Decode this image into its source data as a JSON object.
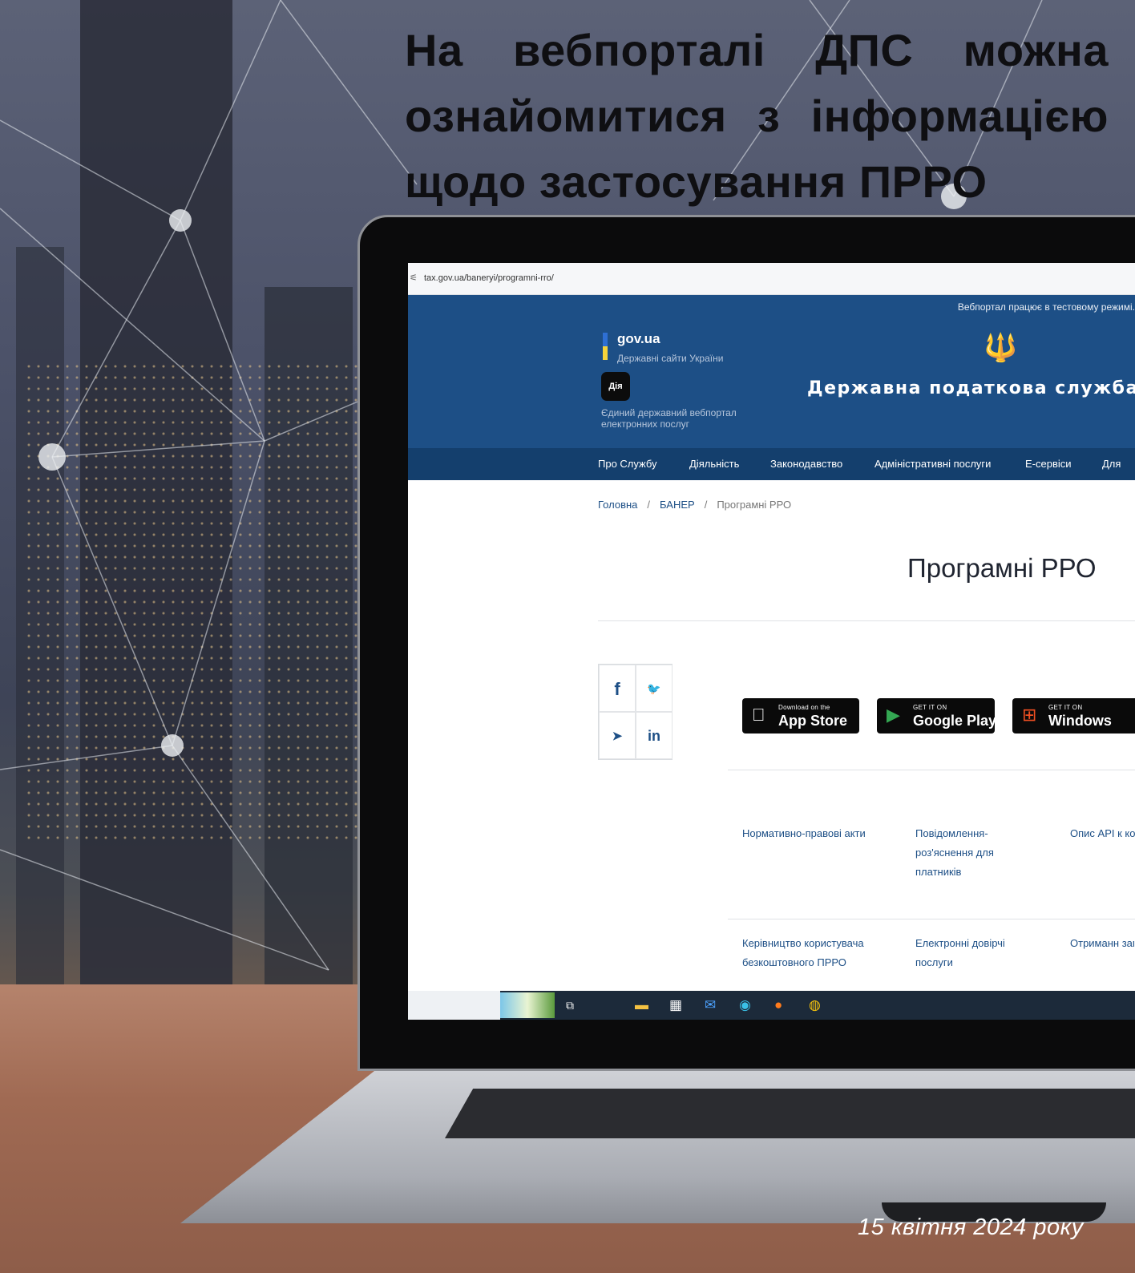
{
  "headline": "На вебпорталі ДПС можна ознайомитися з інформацією щодо застосування ПРРО",
  "date": "15 квітня 2024 року",
  "browser": {
    "url": "tax.gov.ua/baneryi/programni-rro/"
  },
  "site": {
    "test_notice": "Вебпортал працює в тестовому режимі.",
    "gov_title": "gov.ua",
    "gov_subtitle": "Державні сайти України",
    "diia_label": "Дія",
    "diia_caption": "Єдиний державний вебпортал електронних послуг",
    "service_name": "Державна податкова служба Ук"
  },
  "nav": [
    "Про Службу",
    "Діяльність",
    "Законодавство",
    "Адміністративні послуги",
    "Е-сервіси",
    "Для"
  ],
  "breadcrumbs": [
    "Головна",
    "БАНЕР",
    "Програмні РРО"
  ],
  "page_title": "Програмні РРО",
  "share": {
    "facebook": "f",
    "twitter": "🐦",
    "telegram": "➤",
    "linkedin": "in"
  },
  "stores": [
    {
      "small": "Download on the",
      "big": "App Store",
      "icon": "apple-icon"
    },
    {
      "small": "GET IT ON",
      "big": "Google Play",
      "icon": "google-play-icon"
    },
    {
      "small": "GET IT ON",
      "big": "Windows",
      "icon": "windows-icon"
    }
  ],
  "links": [
    "Нормативно-правові акти",
    "Повідомлення-роз'яснення для платників",
    "Опис API к контролю",
    "Керівництво користувача безкоштовного ПРРО",
    "Електронні довірчі послуги",
    "Отриманн запитання"
  ]
}
